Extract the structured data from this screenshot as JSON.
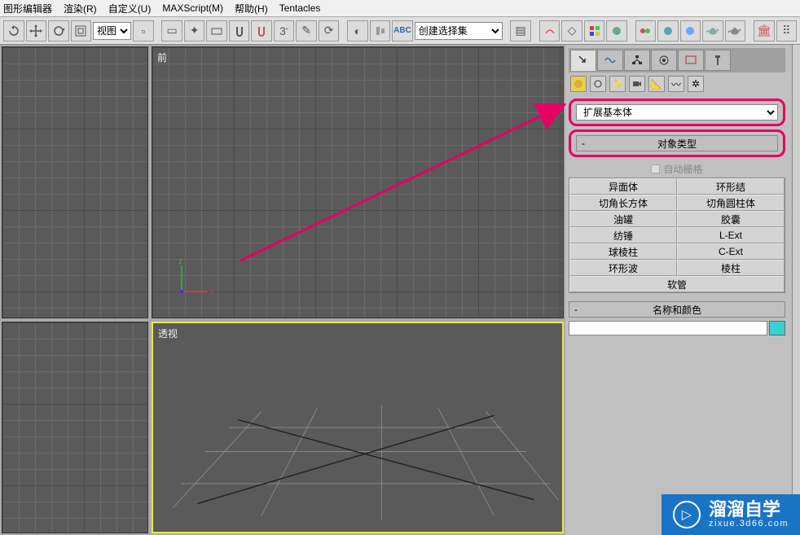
{
  "menu": {
    "items": [
      "图形编辑器",
      "渲染(R)",
      "自定义(U)",
      "MAXScript(M)",
      "帮助(H)",
      "Tentacles"
    ]
  },
  "toolbar": {
    "view_select": "视图",
    "collection_placeholder": "创建选择集"
  },
  "viewports": {
    "top_right_label": "前",
    "bottom_right_label": "透视",
    "axes": {
      "x": "x",
      "z": "z"
    }
  },
  "panel": {
    "category_dropdown": "扩展基本体",
    "object_type_header": "对象类型",
    "auto_grid": "自动栅格",
    "obj_buttons": [
      "异面体",
      "环形结",
      "切角长方体",
      "切角圆柱体",
      "油罐",
      "胶囊",
      "纺锤",
      "L-Ext",
      "球棱柱",
      "C-Ext",
      "环形波",
      "棱柱",
      "软管"
    ],
    "name_color_header": "名称和颜色",
    "rollout_minus": "-"
  },
  "watermark": {
    "title": "溜溜自学",
    "sub": "zixue.3d66.com",
    "play": "▷"
  }
}
